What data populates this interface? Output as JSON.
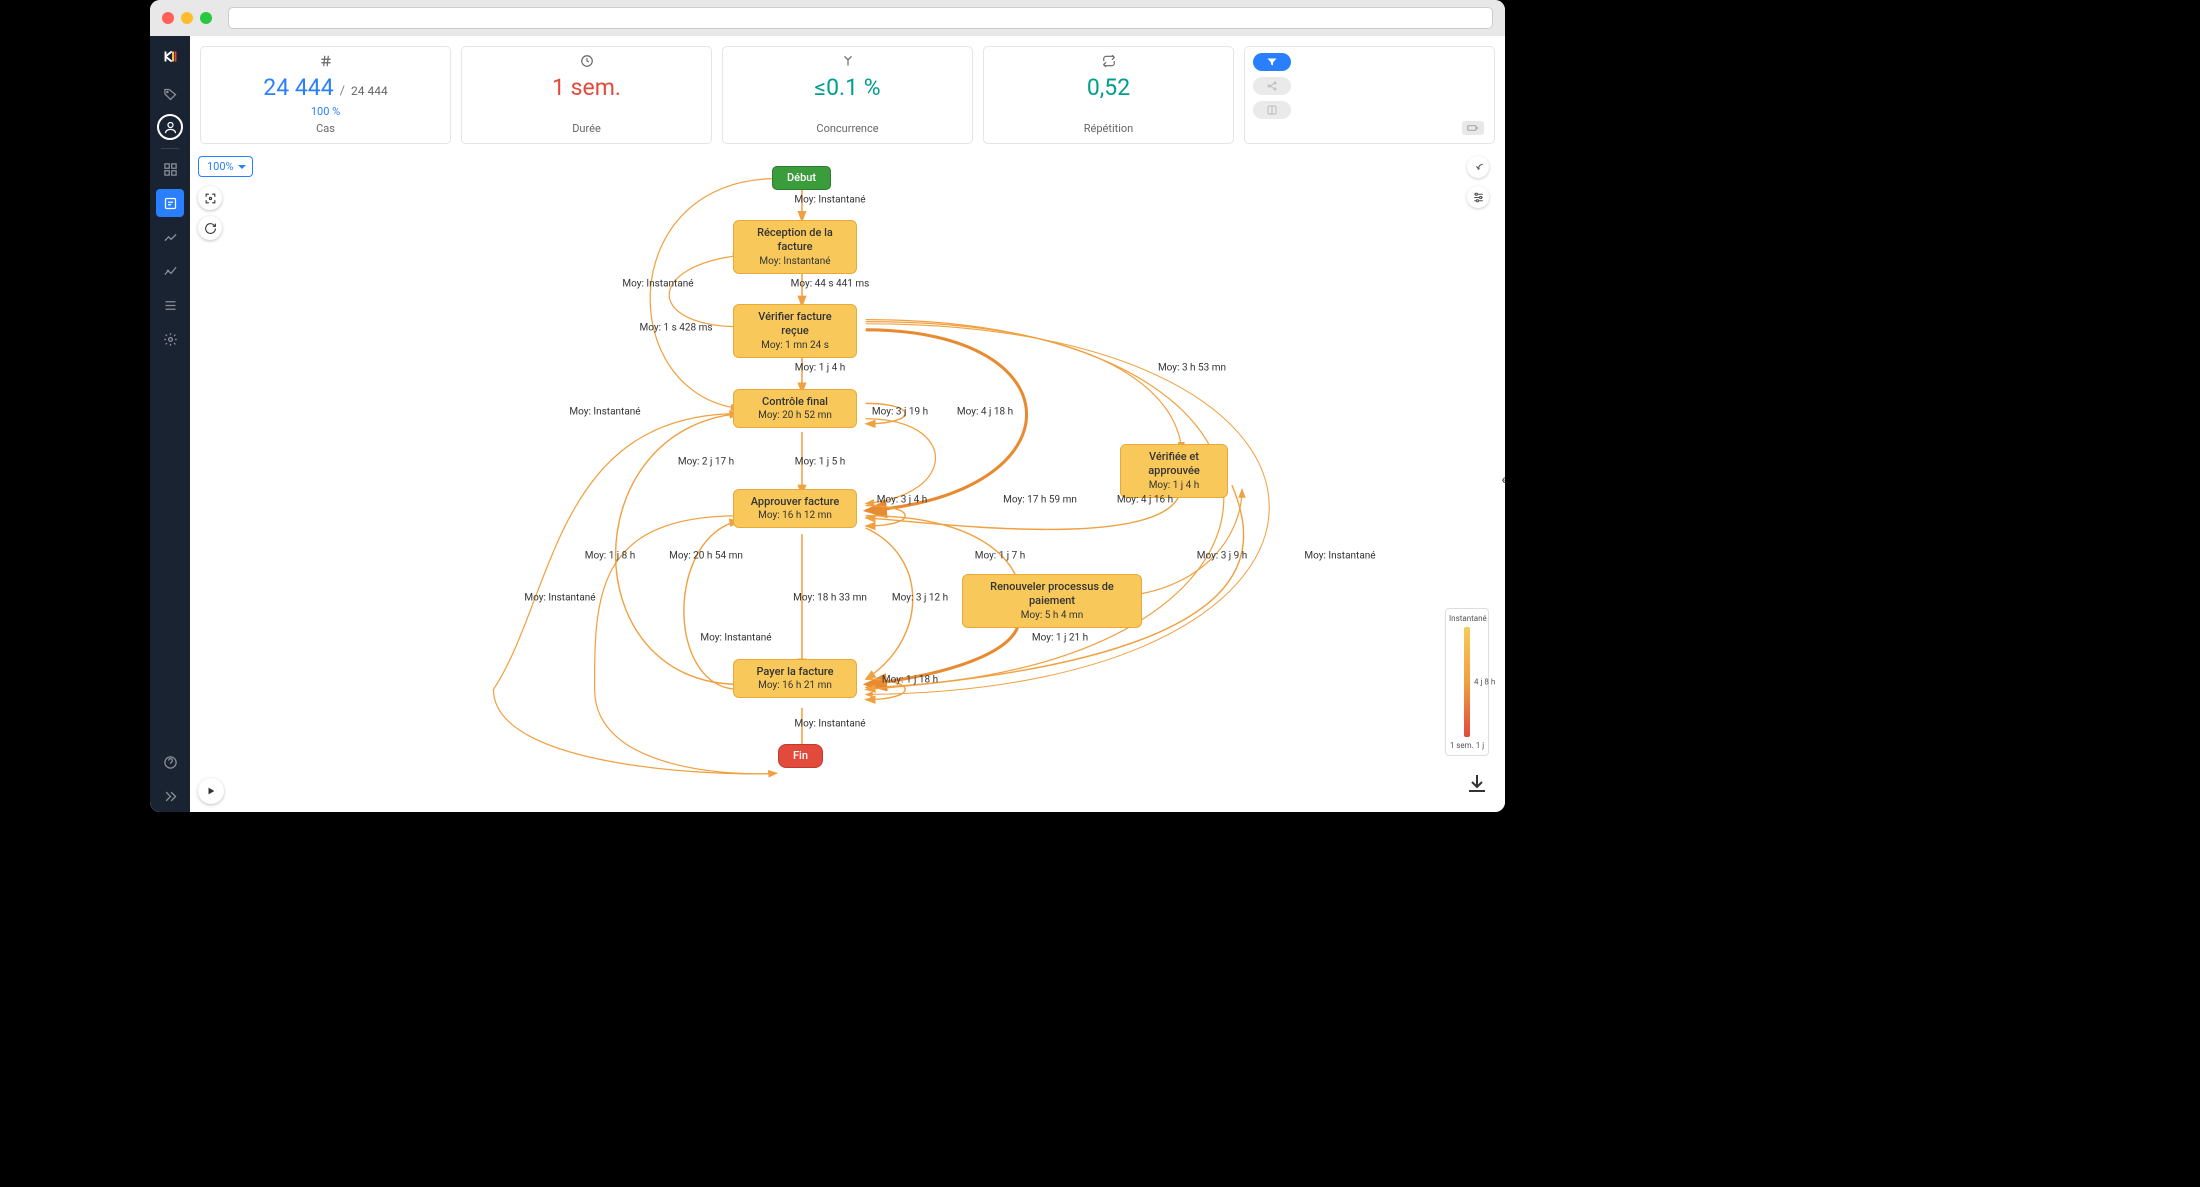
{
  "kpi": {
    "cases": {
      "value": "24 444",
      "total": "24 444",
      "percent": "100 %",
      "label": "Cas"
    },
    "duration": {
      "value": "1 sem.",
      "label": "Durée"
    },
    "concurrency": {
      "value": "≤0.1 %",
      "label": "Concurrence"
    },
    "repetition": {
      "value": "0,52",
      "label": "Répétition"
    }
  },
  "zoom": "100%",
  "legend": {
    "top": "Instantané",
    "mid": "4 j 8 h",
    "bottom": "1 sem. 1 j"
  },
  "nodes": {
    "start": {
      "label": "Début"
    },
    "recv": {
      "line1": "Réception de la facture",
      "line2": "Moy: Instantané"
    },
    "verify": {
      "line1": "Vérifier facture reçue",
      "line2": "Moy: 1 mn 24 s"
    },
    "control": {
      "line1": "Contrôle final",
      "line2": "Moy: 20 h 52 mn"
    },
    "approve": {
      "line1": "Approuver facture",
      "line2": "Moy: 16 h 12 mn"
    },
    "pay": {
      "line1": "Payer la facture",
      "line2": "Moy: 16 h 21 mn"
    },
    "verified": {
      "line1": "Vérifiée et approuvée",
      "line2": "Moy: 1 j 4 h"
    },
    "renew": {
      "line1": "Renouveler processus de paiement",
      "line2": "Moy: 5 h 4 mn"
    },
    "end": {
      "label": "Fin"
    }
  },
  "edges": {
    "e1": "Moy: Instantané",
    "e2": "Moy: 44 s 441 ms",
    "e3": "Moy: Instantané",
    "e4": "Moy: 1 s 428 ms",
    "e5": "Moy: 1 j 4 h",
    "e6": "Moy: 3 h 53 mn",
    "e7": "Moy: Instantané",
    "e8": "Moy: 3 j 19 h",
    "e9": "Moy: 4 j 18 h",
    "e10": "Moy: 2 j 17 h",
    "e11": "Moy: 1 j 5 h",
    "e12": "Moy: 3 j 4 h",
    "e13": "Moy: 17 h 59 mn",
    "e14": "Moy: 4 j 16 h",
    "e15": "Moy: 1 j 8 h",
    "e16": "Moy: 20 h 54 mn",
    "e17": "Moy: 1 j 7 h",
    "e18": "Moy: 3 j 9 h",
    "e19": "Moy: Instantané",
    "e20": "Moy: Instantané",
    "e21": "Moy: 18 h 33 mn",
    "e22": "Moy: 3 j 12 h",
    "e23": "Moy: 1 j 21 h",
    "e24": "Moy: Instantané",
    "e25": "Moy: 1 j 18 h",
    "e26": "Moy: Instantané"
  }
}
